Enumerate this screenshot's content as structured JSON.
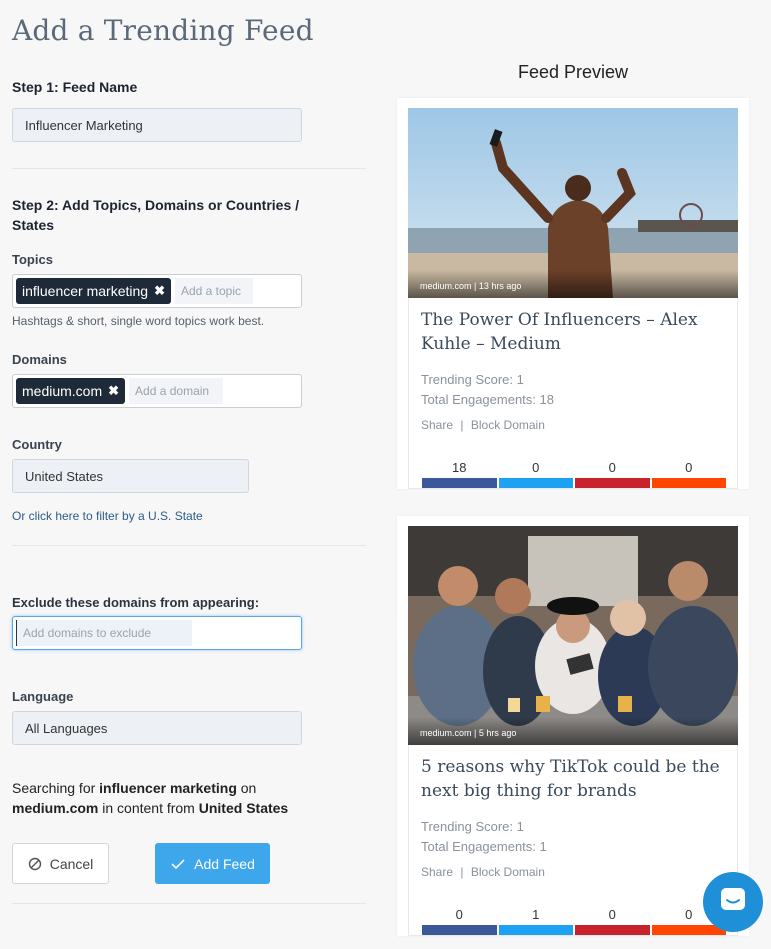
{
  "page_title": "Add a Trending Feed",
  "step1": {
    "label": "Step 1: Feed Name",
    "feed_name": "Influencer Marketing"
  },
  "step2": {
    "label": "Step 2: Add Topics, Domains or Countries / States",
    "topics_label": "Topics",
    "topic_tag": "influencer marketing",
    "topic_placeholder": "Add a topic",
    "topics_hint": "Hashtags & short, single word topics work best.",
    "domains_label": "Domains",
    "domain_tag": "medium.com",
    "domain_placeholder": "Add a domain",
    "country_label": "Country",
    "country_value": "United States",
    "state_link": "Or click here to filter by a U.S. State"
  },
  "exclude": {
    "label": "Exclude these domains from appearing:",
    "placeholder": "Add domains to exclude"
  },
  "language": {
    "label": "Language",
    "value": "All Languages"
  },
  "summary": {
    "prefix": "Searching for ",
    "topic": "influencer marketing",
    "mid1": " on ",
    "domain": "medium.com",
    "mid2": " in content from ",
    "country": "United States"
  },
  "buttons": {
    "cancel": "Cancel",
    "add_feed": "Add Feed"
  },
  "preview": {
    "title": "Feed Preview",
    "cards": [
      {
        "caption": "medium.com | 13 hrs ago",
        "title": "The Power Of Influencers – Alex Kuhle – Medium",
        "trending_score": "Trending Score: 1",
        "total_engagements": "Total Engagements: 18",
        "share": "Share",
        "sep": "|",
        "block": "Block Domain",
        "stats": [
          "18",
          "0",
          "0",
          "0"
        ]
      },
      {
        "caption": "medium.com | 5 hrs ago",
        "title": "5 reasons why TikTok could be the next big thing for brands",
        "trending_score": "Trending Score: 1",
        "total_engagements": "Total Engagements: 1",
        "share": "Share",
        "sep": "|",
        "block": "Block Domain",
        "stats": [
          "0",
          "1",
          "0",
          "0"
        ]
      }
    ]
  },
  "colors": {
    "facebook": "#3b5998",
    "twitter": "#1da1f2",
    "pinterest": "#c8232c",
    "reddit": "#ff4500",
    "primary": "#3ea7ec",
    "chat": "#1f8fd8"
  },
  "icons": {
    "cancel": "ban-icon",
    "add": "check-icon",
    "tag_remove": "close-icon",
    "chat": "chat-icon"
  }
}
